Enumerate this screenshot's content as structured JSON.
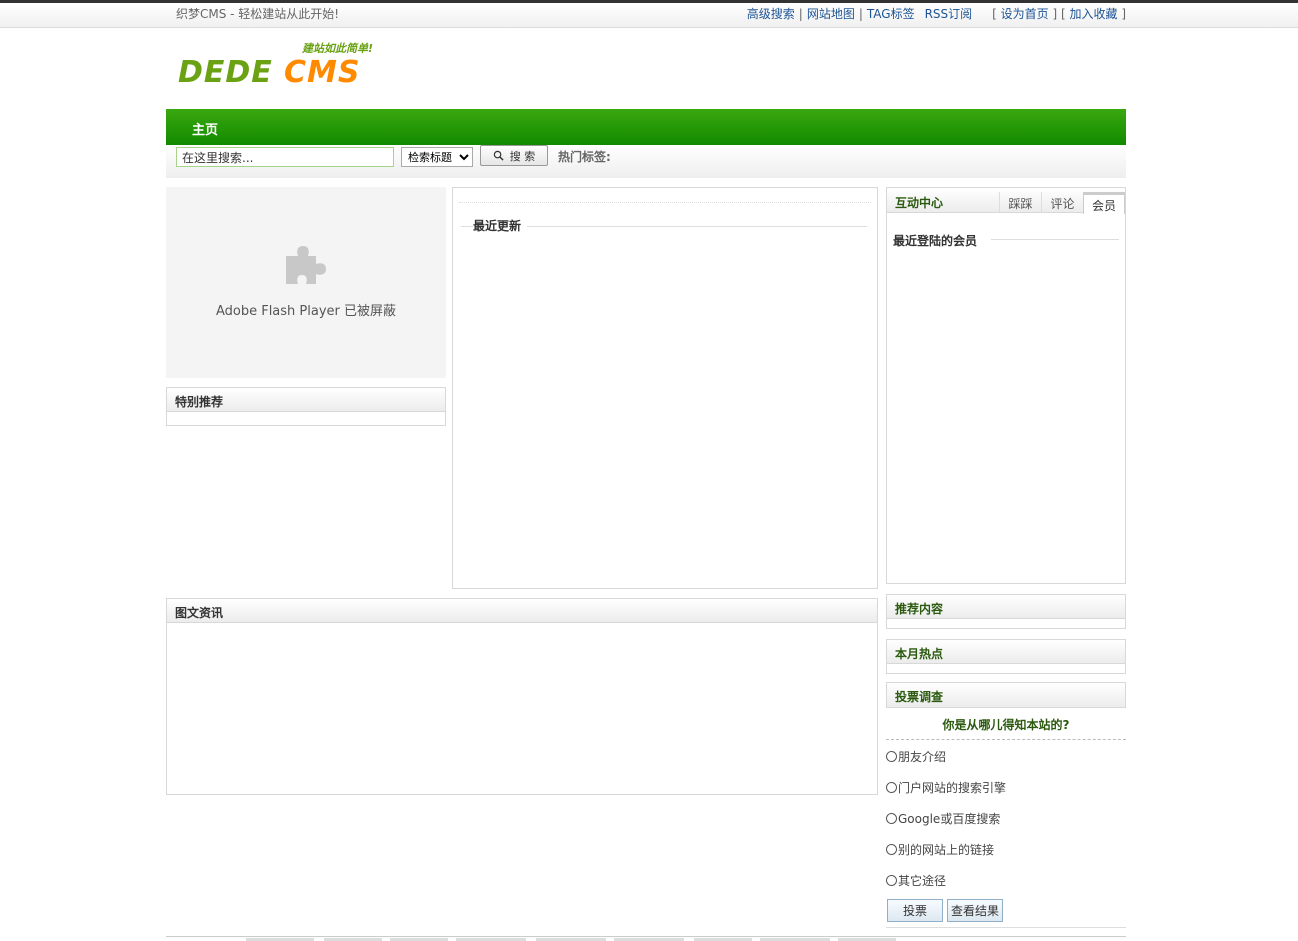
{
  "topbar": {
    "welcome": "织梦CMS - 轻松建站从此开始!",
    "links": [
      "高级搜索",
      "网站地图",
      "TAG标签",
      "RSS订阅"
    ],
    "set_home": "设为首页",
    "add_favorite": "加入收藏"
  },
  "logo": {
    "main_left": "DEDE",
    "main_right": "CMS",
    "slogan": "建站如此简单!"
  },
  "nav": {
    "home": "主页"
  },
  "search": {
    "input_value": "在这里搜索...",
    "select_value": "检索标题",
    "button_label": "搜 索",
    "hot_tags_label": "热门标签:"
  },
  "flash": {
    "message": "Adobe Flash Player 已被屏蔽"
  },
  "special": {
    "title": "特别推荐"
  },
  "latest": {
    "title": "最近更新"
  },
  "interact": {
    "title": "互动中心",
    "tabs": [
      "踩踩",
      "评论",
      "会员"
    ],
    "members_title": "最近登陆的会员"
  },
  "pictext": {
    "title": "图文资讯"
  },
  "recommend": {
    "title": "推荐内容"
  },
  "monthhot": {
    "title": "本月热点"
  },
  "vote": {
    "title": "投票调查",
    "question": "你是从哪儿得知本站的?",
    "options": [
      "朋友介绍",
      "门户网站的搜索引擎",
      "Google或百度搜索",
      "别的网站上的链接",
      "其它途径"
    ],
    "submit_label": "投票",
    "result_label": "查看结果"
  },
  "colors": {
    "nav_green": "#118a00",
    "link_blue": "#1e5494",
    "title_green": "#2b5a0f",
    "logo_green": "#6aa214",
    "logo_orange": "#ff8a00"
  }
}
